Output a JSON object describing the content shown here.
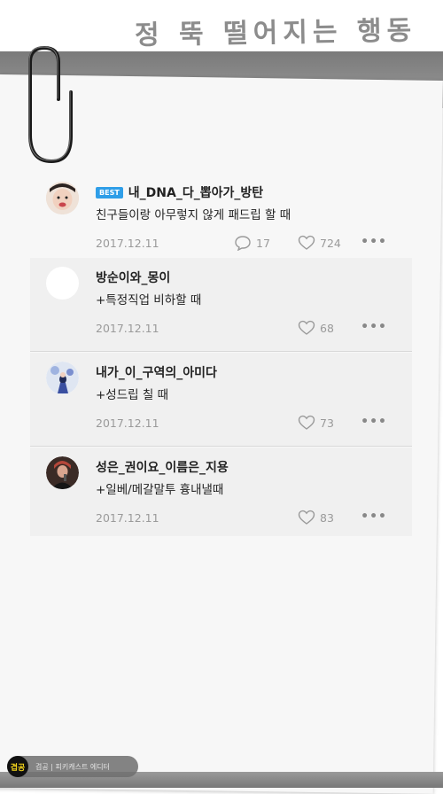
{
  "header": {
    "title": "정 뚝 떨어지는 행동"
  },
  "comments": [
    {
      "best_badge": "BEST",
      "username": "내_DNA_다_뽑아가_방탄",
      "text": "친구들이랑 아무렇지 않게 패드립 할 때",
      "date": "2017.12.11",
      "reply_count": "17",
      "like_count": "724"
    },
    {
      "username": "방순이와_몽이",
      "text": "+특정직업 비하할 때",
      "date": "2017.12.11",
      "like_count": "68"
    },
    {
      "username": "내가_이_구역의_아미다",
      "text": "+성드립 칠 때",
      "date": "2017.12.11",
      "like_count": "73"
    },
    {
      "username": "성은_권이요_이름은_지용",
      "text": "+일베/메갈말투 흉내낼때",
      "date": "2017.12.11",
      "like_count": "83"
    }
  ],
  "more_label": "•••",
  "footer": {
    "logo_text": "겹공",
    "caption": "겹공 | 피키캐스트 에디터"
  },
  "colors": {
    "best_badge": "#2f9ee8",
    "logo_text": "#f2d21b"
  }
}
